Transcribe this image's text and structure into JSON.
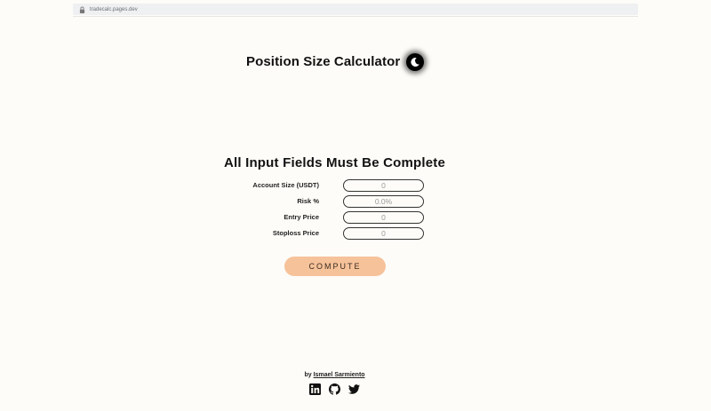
{
  "browser": {
    "url": "tradecalc.pages.dev"
  },
  "header": {
    "title": "Position Size Calculator",
    "theme_icon": "moon-icon"
  },
  "form": {
    "heading": "All Input Fields Must Be Complete",
    "fields": [
      {
        "label": "Account Size (USDT)",
        "placeholder": "0"
      },
      {
        "label": "Risk %",
        "placeholder": "0.0%"
      },
      {
        "label": "Entry Price",
        "placeholder": "0"
      },
      {
        "label": "Stoploss Price",
        "placeholder": "0"
      }
    ],
    "compute_label": "COMPUTE",
    "compute_color": "#f6c29a"
  },
  "footer": {
    "by": "by",
    "author": "Ismael Sarmiento",
    "social_icons": [
      "linkedin-icon",
      "github-icon",
      "twitter-icon"
    ]
  }
}
